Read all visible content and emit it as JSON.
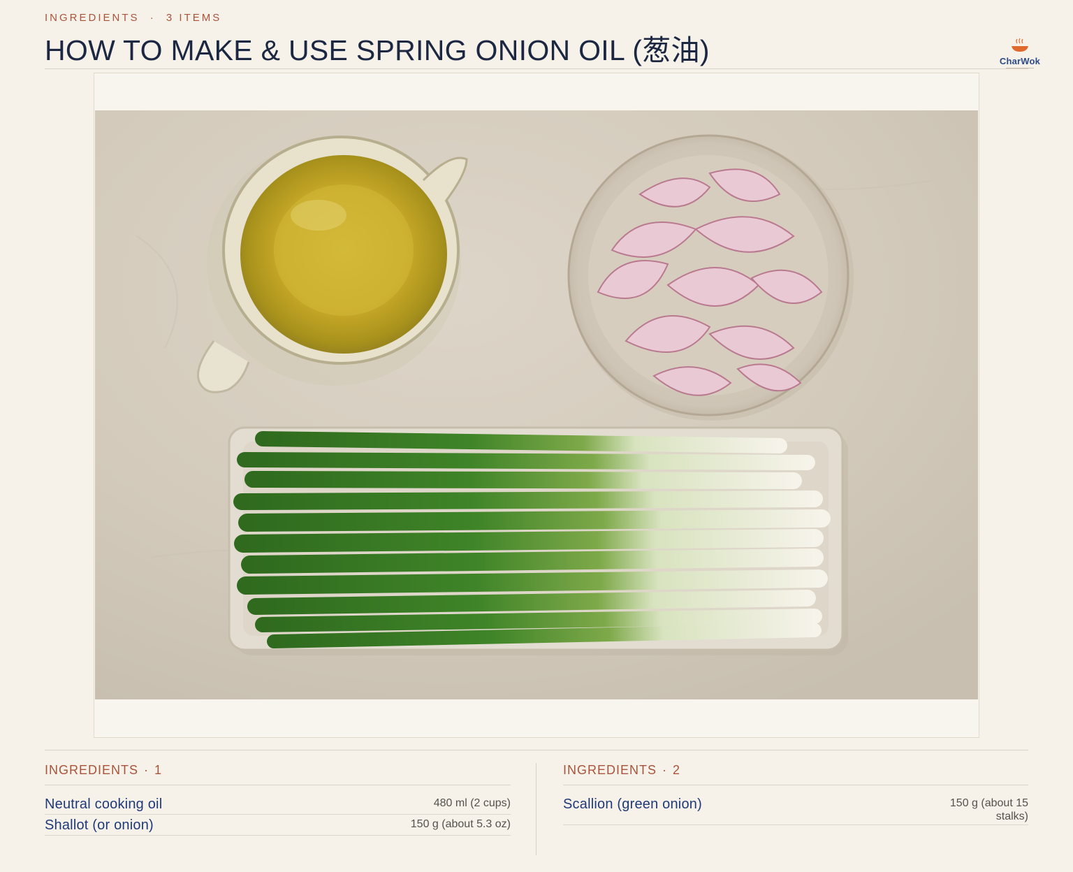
{
  "header": {
    "eyebrow_label": "INGREDIENTS",
    "eyebrow_sep": "·",
    "eyebrow_count": "3 ITEMS",
    "title": "HOW TO MAKE & USE SPRING ONION OIL (葱油)"
  },
  "brand": {
    "name": "CharWok",
    "icon": "wok-steam-icon",
    "accent": "#e0692e",
    "color": "#2c4a86"
  },
  "photo": {
    "subject": "ingredients-flatlay",
    "items": [
      "oil-jug",
      "shallot-bowl",
      "scallion-tray"
    ]
  },
  "sections": [
    {
      "label": "INGREDIENTS",
      "sep": "·",
      "number": "1",
      "items": [
        {
          "name": "Neutral cooking oil",
          "qty": "480 ml (2 cups)"
        },
        {
          "name": "Shallot (or onion)",
          "qty": "150 g (about 5.3 oz)"
        }
      ]
    },
    {
      "label": "INGREDIENTS",
      "sep": "·",
      "number": "2",
      "items": [
        {
          "name": "Scallion (green onion)",
          "qty": "150 g (about 15 stalks)"
        }
      ]
    }
  ],
  "colors": {
    "background": "#f6f2ea",
    "accent": "#a9543a",
    "title": "#1c2741",
    "item_name": "#203a77"
  }
}
